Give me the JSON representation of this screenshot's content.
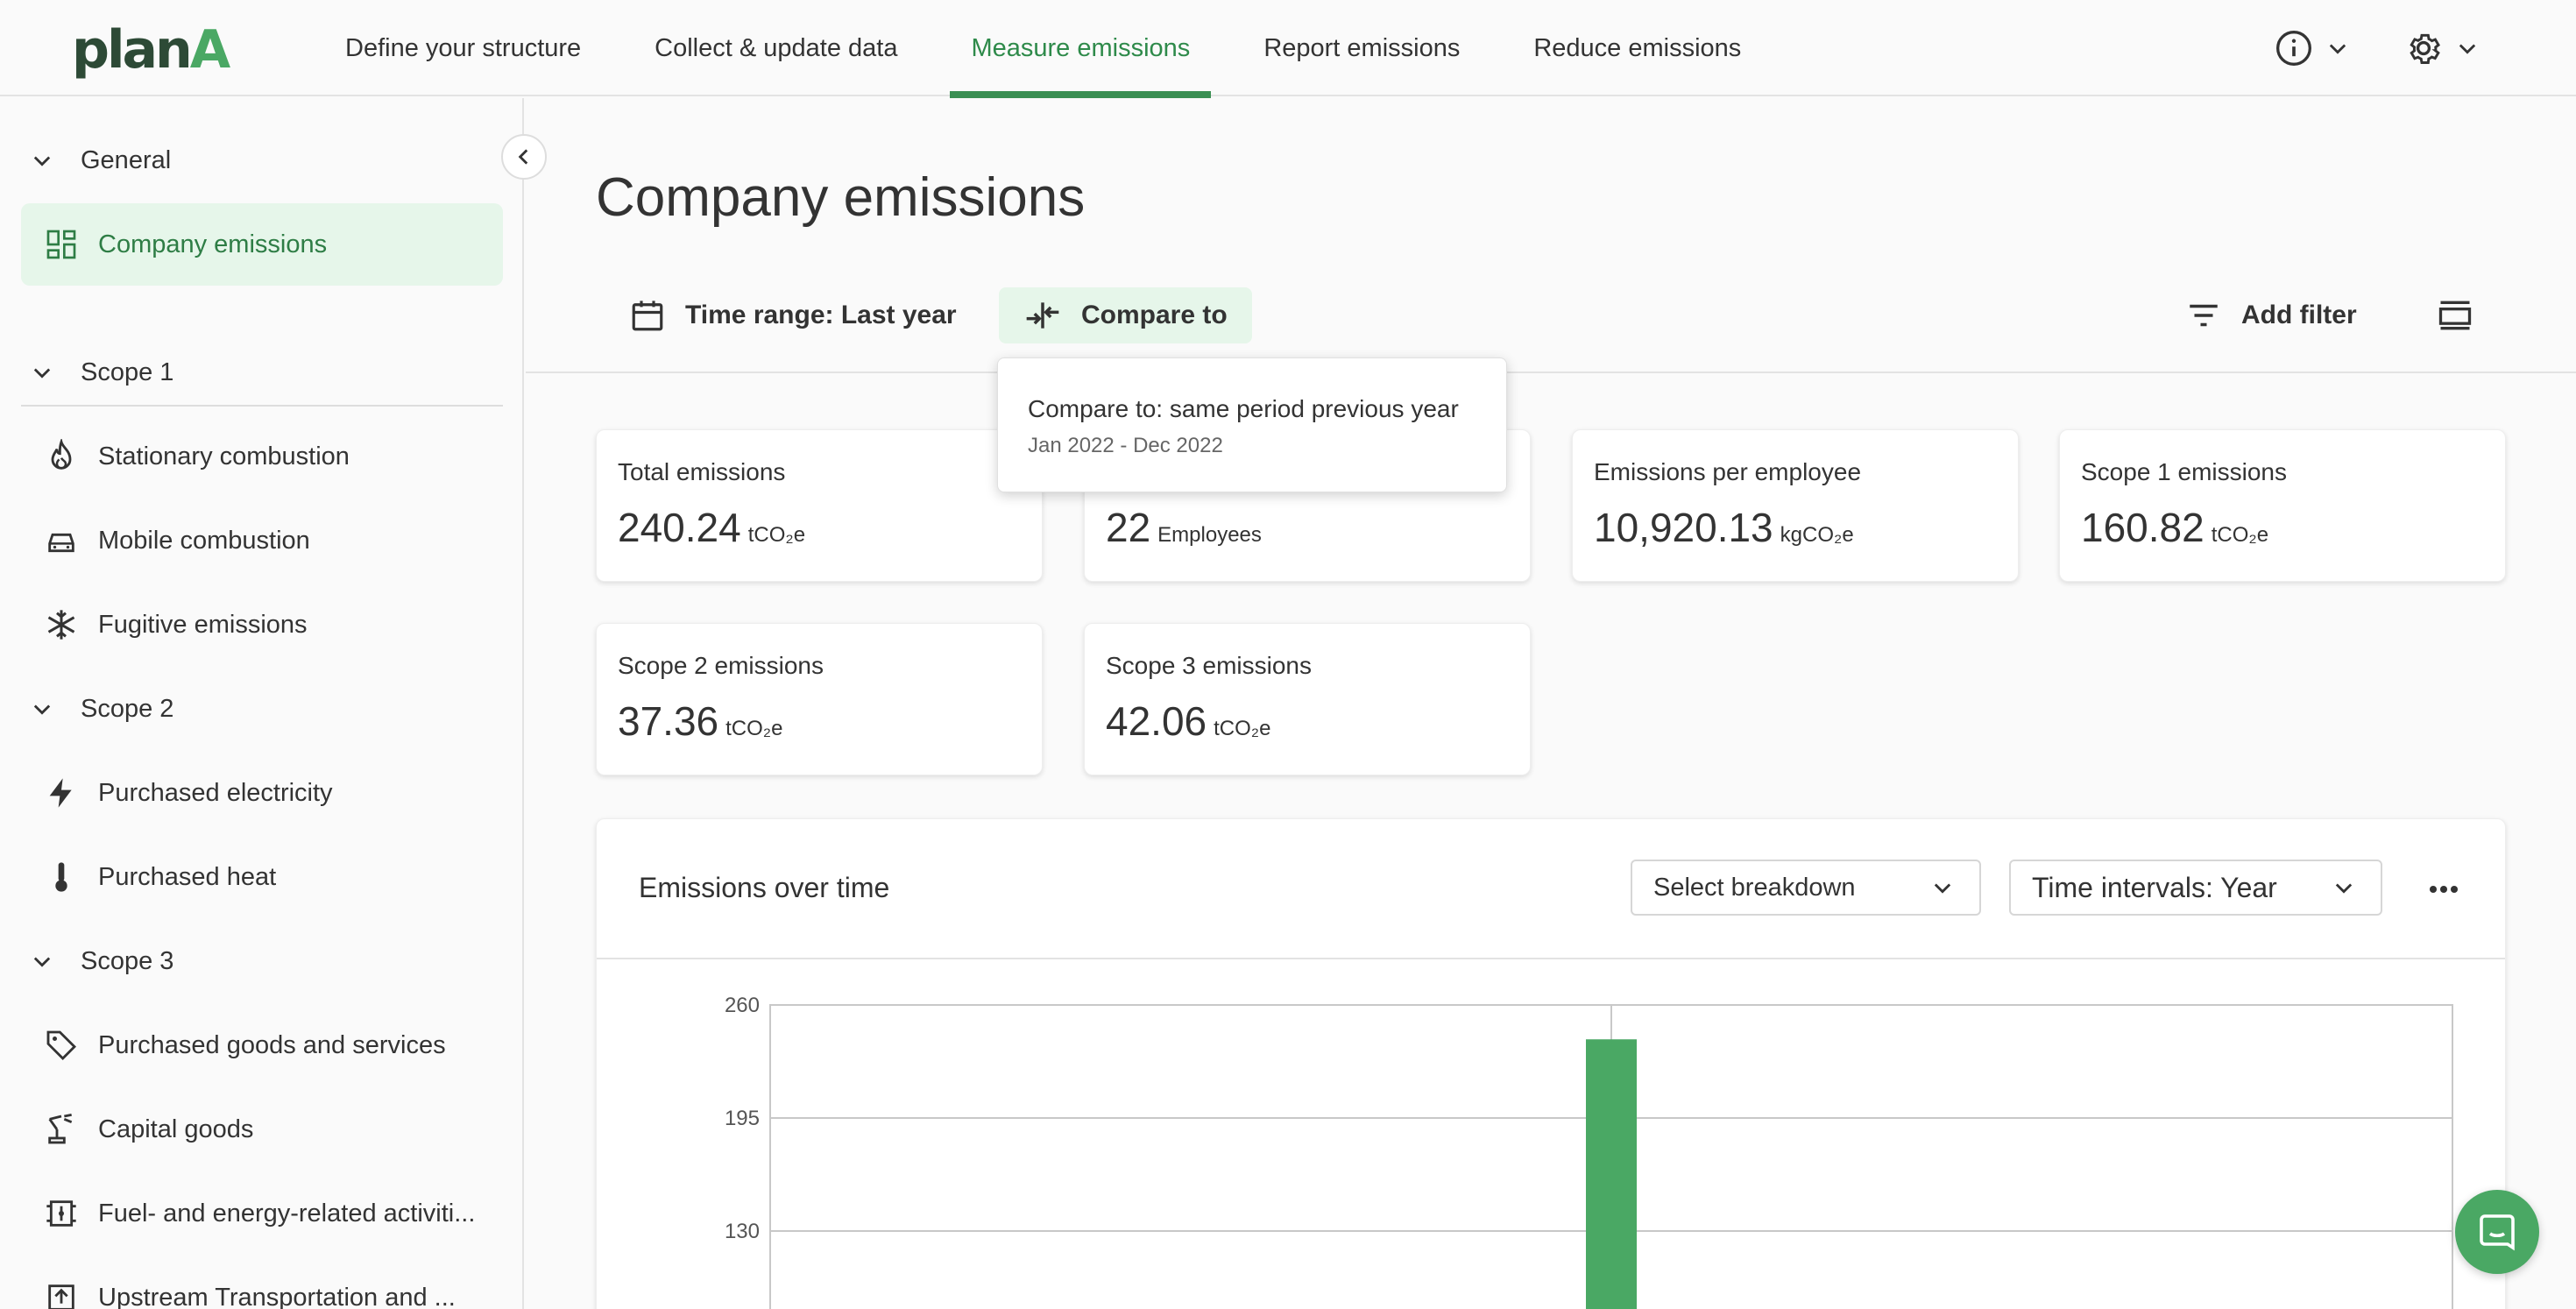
{
  "app": {
    "logo_main": "plan",
    "logo_accent": "A"
  },
  "nav": {
    "items": [
      {
        "label": "Define your structure"
      },
      {
        "label": "Collect & update data"
      },
      {
        "label": "Measure emissions",
        "active": true
      },
      {
        "label": "Report emissions"
      },
      {
        "label": "Reduce emissions"
      }
    ]
  },
  "sidebar": {
    "general": {
      "label": "General"
    },
    "company_emissions": {
      "label": "Company emissions"
    },
    "scope1": {
      "label": "Scope 1"
    },
    "stationary": {
      "label": "Stationary combustion"
    },
    "mobile": {
      "label": "Mobile combustion"
    },
    "fugitive": {
      "label": "Fugitive emissions"
    },
    "scope2": {
      "label": "Scope 2"
    },
    "electricity": {
      "label": "Purchased electricity"
    },
    "heat": {
      "label": "Purchased heat"
    },
    "scope3": {
      "label": "Scope 3"
    },
    "goods": {
      "label": "Purchased goods and services"
    },
    "capital": {
      "label": "Capital goods"
    },
    "fuel": {
      "label": "Fuel- and energy-related activiti..."
    },
    "upstream": {
      "label": "Upstream Transportation and ..."
    }
  },
  "main": {
    "title": "Company emissions",
    "time_range": "Time range: Last year",
    "compare_to": "Compare to",
    "add_filter": "Add filter",
    "tooltip": {
      "line1": "Compare to: same period previous year",
      "line2": "Jan 2022 - Dec 2022"
    },
    "cards": [
      {
        "label": "Total emissions",
        "value": "240.24",
        "unit": "tCO₂e"
      },
      {
        "label": "",
        "value": "22",
        "unit": "Employees"
      },
      {
        "label": "Emissions per employee",
        "value": "10,920.13",
        "unit": "kgCO₂e"
      },
      {
        "label": "Scope 1 emissions",
        "value": "160.82",
        "unit": "tCO₂e"
      },
      {
        "label": "Scope 2 emissions",
        "value": "37.36",
        "unit": "tCO₂e"
      },
      {
        "label": "Scope 3 emissions",
        "value": "42.06",
        "unit": "tCO₂e"
      }
    ],
    "panel": {
      "title": "Emissions over time",
      "breakdown": "Select breakdown",
      "intervals": "Time intervals: Year"
    }
  },
  "chart_data": {
    "type": "bar",
    "yticks": [
      "260",
      "195",
      "130"
    ],
    "ylim": [
      130,
      260
    ],
    "values": [
      240.24
    ],
    "bar_color": "#4aa864"
  },
  "colors": {
    "accent": "#2e8a4a",
    "brand_dark": "#2d4a36",
    "brand_green": "#4aa864",
    "active_bg": "#e6f6ea"
  }
}
